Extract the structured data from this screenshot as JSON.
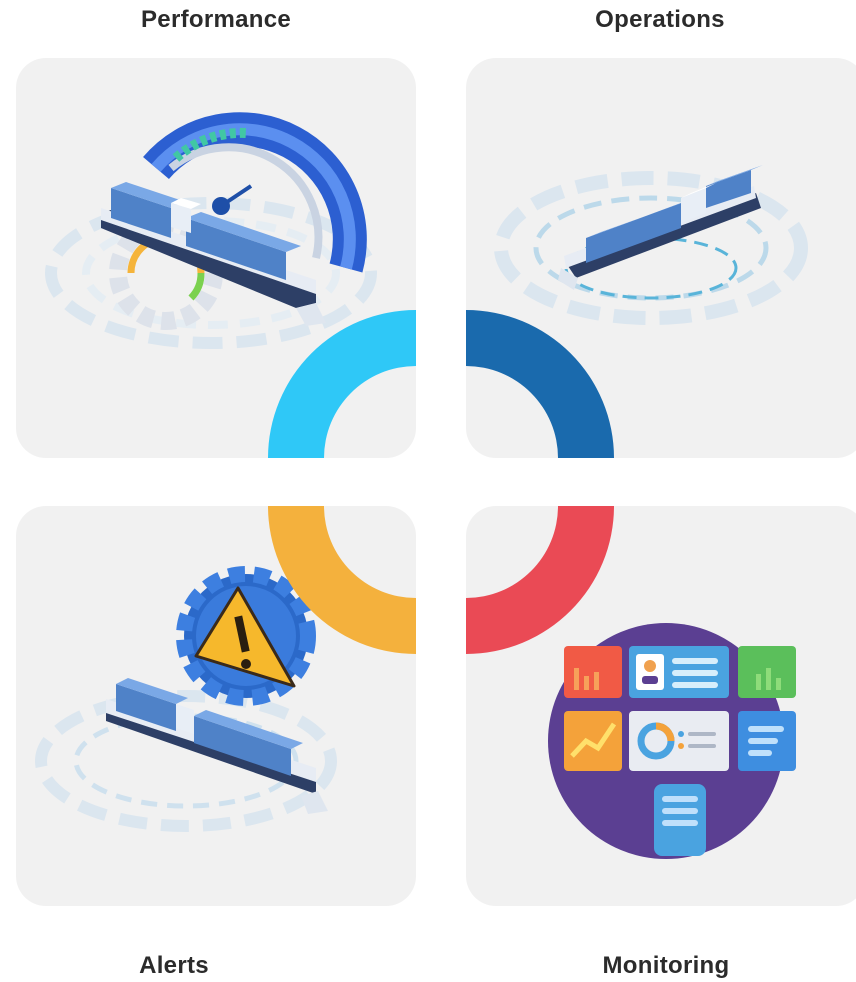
{
  "quadrants": {
    "performance": {
      "label": "Performance",
      "ring_color": "#2fc8f7",
      "icon": "ship-speedometer-icon"
    },
    "operations": {
      "label": "Operations",
      "ring_color": "#1a6aad",
      "icon": "ship-operations-icon"
    },
    "alerts": {
      "label": "Alerts",
      "ring_color": "#f4b13d",
      "icon": "ship-warning-gear-icon"
    },
    "monitoring": {
      "label": "Monitoring",
      "ring_color": "#ea4a55",
      "icon": "monitoring-dashboard-icon"
    }
  },
  "colors": {
    "card_background": "#f1f1f1",
    "label_text": "#2b2b2b"
  }
}
